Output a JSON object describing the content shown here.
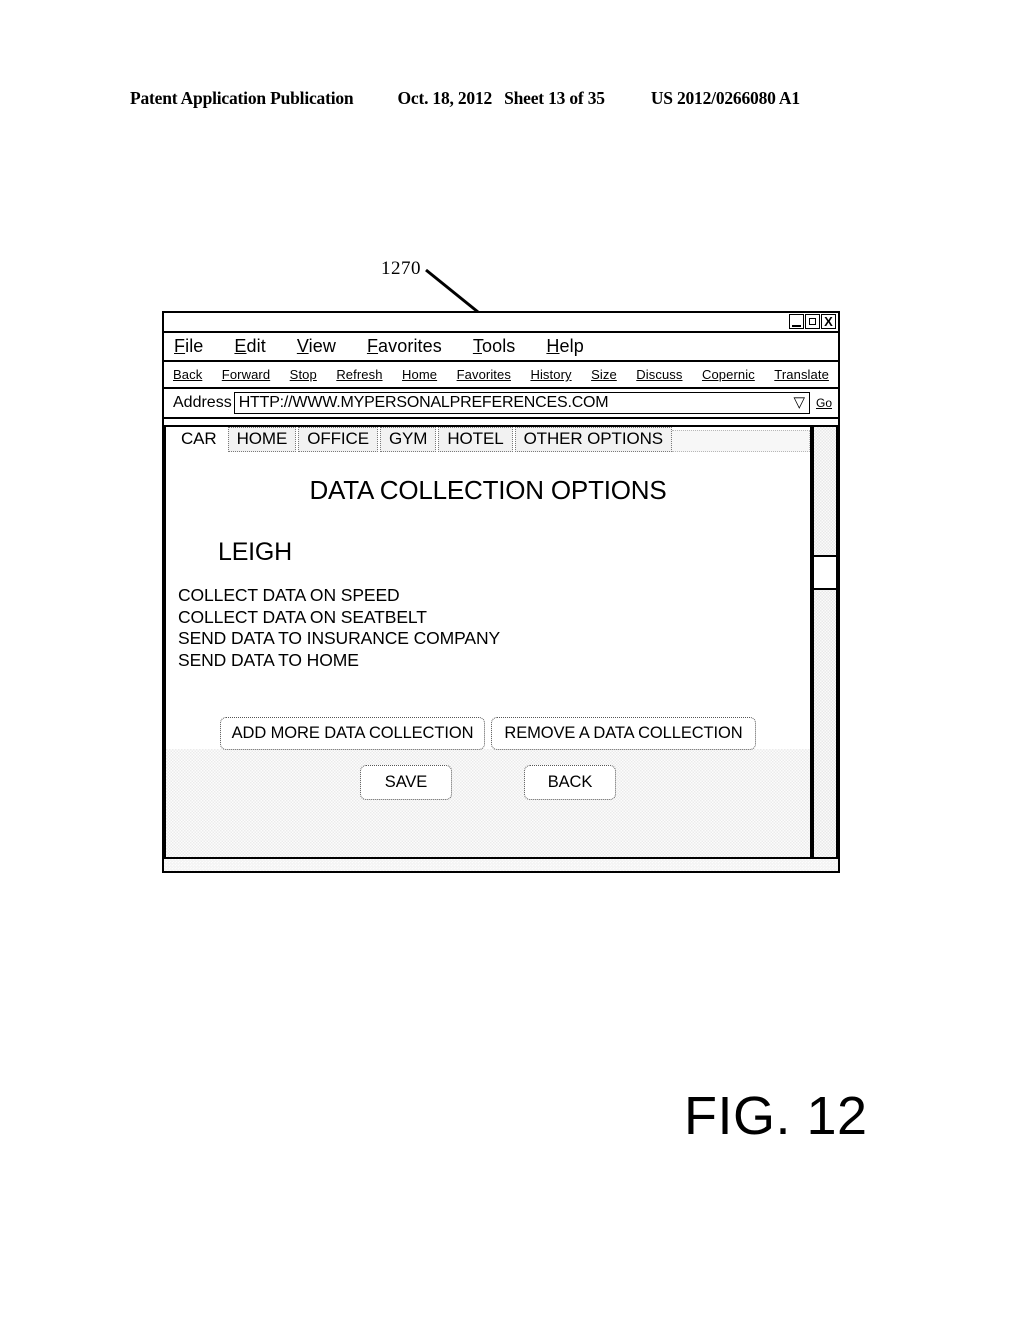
{
  "patent_header": {
    "publication": "Patent Application Publication",
    "date": "Oct. 18, 2012",
    "sheet": "Sheet 13 of 35",
    "number": "US 2012/0266080 A1"
  },
  "callout": {
    "reference_numeral": "1270"
  },
  "figure": {
    "label": "FIG. 12"
  },
  "browser": {
    "title_bar": {
      "title": "",
      "controls": [
        {
          "name": "minimize",
          "glyph": ""
        },
        {
          "name": "maximize",
          "glyph": ""
        },
        {
          "name": "close",
          "glyph": "X"
        }
      ]
    },
    "menu": [
      {
        "mnemonic": "F",
        "rest": "ile"
      },
      {
        "mnemonic": "E",
        "rest": "dit"
      },
      {
        "mnemonic": "V",
        "rest": "iew"
      },
      {
        "mnemonic": "F",
        "rest": "avorites"
      },
      {
        "mnemonic": "T",
        "rest": "ools"
      },
      {
        "mnemonic": "H",
        "rest": "elp"
      }
    ],
    "toolbar": [
      "Back",
      "Forward",
      "Stop",
      "Refresh",
      "Home",
      "Favorites",
      "History",
      "Size",
      "Discuss",
      "Copernic",
      "Translate"
    ],
    "address": {
      "label": "Address",
      "value": "HTTP://WWW.MYPERSONALPREFERENCES.COM",
      "placeholder": "HTTP://",
      "dropdown_icon": "▽",
      "go_label": "Go"
    }
  },
  "page": {
    "tabs": [
      {
        "label": "CAR",
        "active": true
      },
      {
        "label": "HOME",
        "active": false
      },
      {
        "label": "OFFICE",
        "active": false
      },
      {
        "label": "GYM",
        "active": false
      },
      {
        "label": "HOTEL",
        "active": false
      },
      {
        "label": "OTHER OPTIONS",
        "active": false
      }
    ],
    "title": "DATA COLLECTION OPTIONS",
    "user_name": "LEIGH",
    "options": [
      "COLLECT DATA ON SPEED",
      "COLLECT DATA ON SEATBELT",
      "SEND DATA TO INSURANCE COMPANY",
      "SEND DATA TO HOME"
    ],
    "buttons": {
      "add": "ADD MORE DATA COLLECTION",
      "remove": "REMOVE A DATA COLLECTION",
      "save": "SAVE",
      "back": "BACK"
    }
  },
  "colors": {
    "ink": "#000000",
    "paper": "#ffffff",
    "panel_gray": "#ebebeb",
    "tab_inactive": "#f2f2f2"
  }
}
